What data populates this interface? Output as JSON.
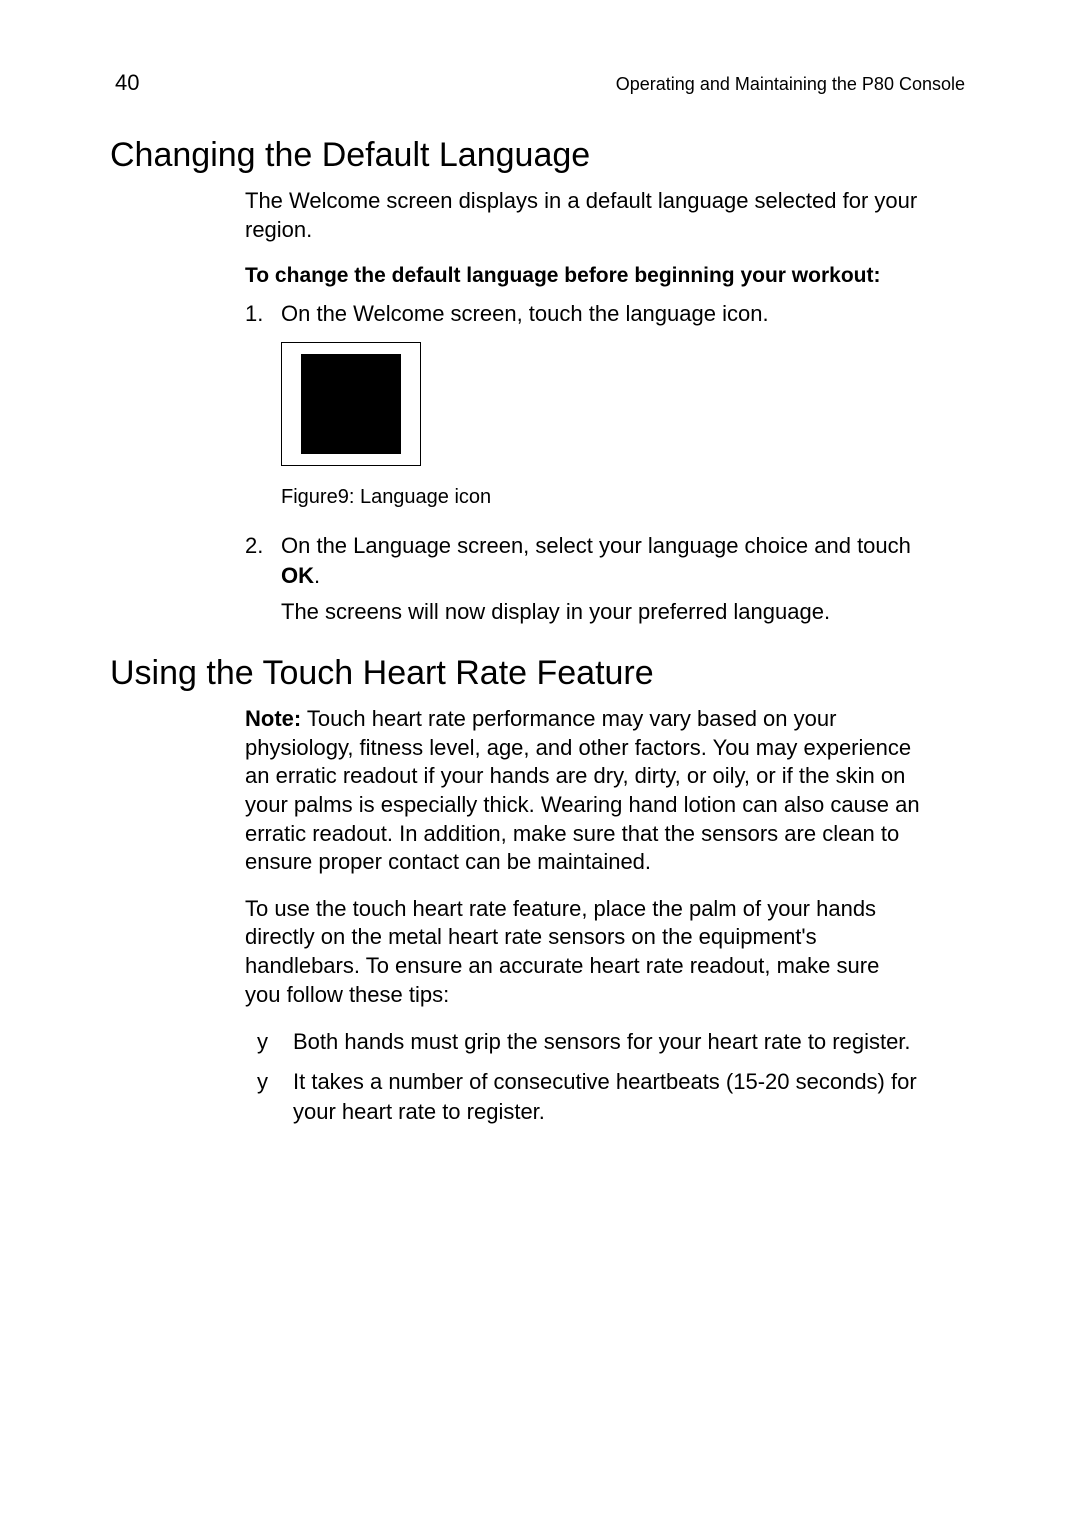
{
  "header": {
    "page_number": "40",
    "title": "Operating and Maintaining the P80 Console"
  },
  "section1": {
    "heading": "Changing the Default Language",
    "intro": "The Welcome screen displays in a default language selected for your region.",
    "subhead": "To change the default language before beginning your workout:",
    "step1_marker": "1.",
    "step1_text": "On the Welcome screen, touch the language icon.",
    "figure_caption_prefix": "Figure",
    "figure_number": "9",
    "figure_caption_text": ": Language icon",
    "step2_marker": "2.",
    "step2_text_a": "On the Language screen, select your language choice and touch ",
    "step2_ok": "OK",
    "step2_text_b": ".",
    "step2_result": "The screens will now display in your preferred language."
  },
  "section2": {
    "heading": "Using the Touch Heart Rate Feature",
    "note_label": "Note:",
    "note_text": " Touch heart rate performance may vary based on your physiology, fitness level, age, and other factors. You may experience an erratic readout if your hands are dry, dirty, or oily, or if the skin on your palms is especially thick. Wearing hand lotion can also cause an erratic readout. In addition, make sure that the sensors are clean to ensure proper contact can be maintained.",
    "usage_text": "To use the touch heart rate feature, place the palm of your hands directly on the metal heart rate sensors on the equipment's handlebars. To ensure an accurate heart rate readout, make sure you follow these tips:",
    "bullets": [
      {
        "marker": "y",
        "text": "Both hands must grip the sensors for your heart rate to register."
      },
      {
        "marker": "y",
        "text": "It takes a number of consecutive heartbeats (15-20 seconds) for your heart rate to register."
      }
    ]
  }
}
